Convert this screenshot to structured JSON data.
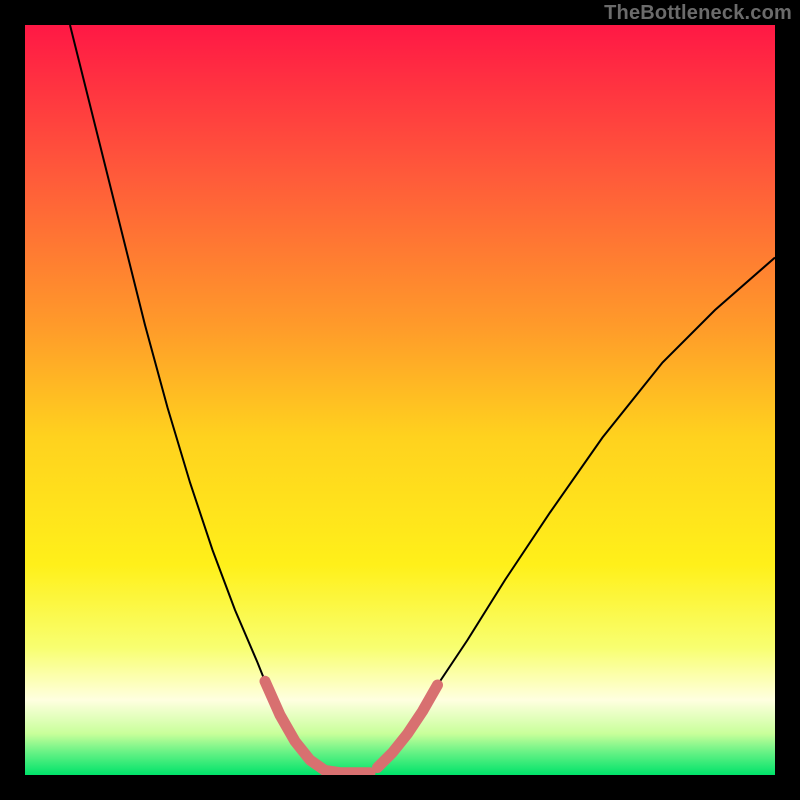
{
  "watermark": "TheBottleneck.com",
  "chart_data": {
    "type": "line",
    "title": "",
    "xlabel": "",
    "ylabel": "",
    "xlim": [
      0,
      100
    ],
    "ylim": [
      0,
      100
    ],
    "background_gradient": {
      "stops": [
        {
          "offset": 0.0,
          "color": "#ff1845"
        },
        {
          "offset": 0.2,
          "color": "#ff5a3a"
        },
        {
          "offset": 0.4,
          "color": "#ff9a2a"
        },
        {
          "offset": 0.55,
          "color": "#ffd21e"
        },
        {
          "offset": 0.72,
          "color": "#fff01a"
        },
        {
          "offset": 0.83,
          "color": "#f8ff70"
        },
        {
          "offset": 0.9,
          "color": "#ffffe0"
        },
        {
          "offset": 0.945,
          "color": "#c8ff9a"
        },
        {
          "offset": 0.97,
          "color": "#66f285"
        },
        {
          "offset": 1.0,
          "color": "#00e36a"
        }
      ]
    },
    "series": [
      {
        "name": "bottleneck-curve",
        "type": "line",
        "stroke": "#000000",
        "stroke_width": 2,
        "points": [
          {
            "x": 6.0,
            "y": 100.0
          },
          {
            "x": 8.0,
            "y": 92.0
          },
          {
            "x": 10.0,
            "y": 84.0
          },
          {
            "x": 13.0,
            "y": 72.0
          },
          {
            "x": 16.0,
            "y": 60.0
          },
          {
            "x": 19.0,
            "y": 49.0
          },
          {
            "x": 22.0,
            "y": 39.0
          },
          {
            "x": 25.0,
            "y": 30.0
          },
          {
            "x": 28.0,
            "y": 22.0
          },
          {
            "x": 31.0,
            "y": 15.0
          },
          {
            "x": 33.0,
            "y": 10.0
          },
          {
            "x": 35.0,
            "y": 6.0
          },
          {
            "x": 37.0,
            "y": 3.0
          },
          {
            "x": 39.0,
            "y": 1.0
          },
          {
            "x": 41.0,
            "y": 0.3
          },
          {
            "x": 43.0,
            "y": 0.3
          },
          {
            "x": 45.0,
            "y": 0.3
          },
          {
            "x": 47.0,
            "y": 1.0
          },
          {
            "x": 49.0,
            "y": 3.0
          },
          {
            "x": 52.0,
            "y": 7.0
          },
          {
            "x": 55.0,
            "y": 12.0
          },
          {
            "x": 59.0,
            "y": 18.0
          },
          {
            "x": 64.0,
            "y": 26.0
          },
          {
            "x": 70.0,
            "y": 35.0
          },
          {
            "x": 77.0,
            "y": 45.0
          },
          {
            "x": 85.0,
            "y": 55.0
          },
          {
            "x": 92.0,
            "y": 62.0
          },
          {
            "x": 100.0,
            "y": 69.0
          }
        ]
      },
      {
        "name": "highlight-left",
        "type": "line",
        "stroke": "#d87070",
        "stroke_width": 11,
        "linecap": "round",
        "points": [
          {
            "x": 32.0,
            "y": 12.5
          },
          {
            "x": 34.0,
            "y": 8.0
          },
          {
            "x": 36.0,
            "y": 4.5
          },
          {
            "x": 38.0,
            "y": 2.0
          },
          {
            "x": 40.0,
            "y": 0.6
          },
          {
            "x": 42.0,
            "y": 0.3
          },
          {
            "x": 44.0,
            "y": 0.3
          },
          {
            "x": 46.0,
            "y": 0.3
          }
        ]
      },
      {
        "name": "highlight-right",
        "type": "line",
        "stroke": "#d87070",
        "stroke_width": 11,
        "linecap": "round",
        "points": [
          {
            "x": 47.0,
            "y": 1.0
          },
          {
            "x": 49.0,
            "y": 3.0
          },
          {
            "x": 51.0,
            "y": 5.5
          },
          {
            "x": 53.0,
            "y": 8.5
          },
          {
            "x": 55.0,
            "y": 12.0
          }
        ]
      }
    ]
  }
}
